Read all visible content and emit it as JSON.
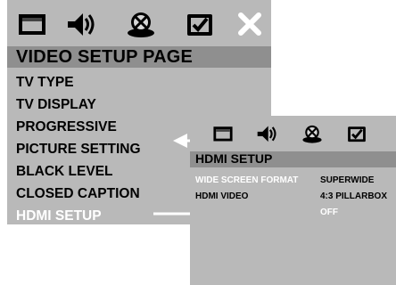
{
  "main_panel": {
    "icons": [
      "tv-screen-icon",
      "speaker-sound-icon",
      "disc-icon",
      "checked-screen-icon",
      "close-icon"
    ],
    "title": "VIDEO SETUP PAGE",
    "menu_items": [
      {
        "label": "TV TYPE",
        "active": false
      },
      {
        "label": "TV DISPLAY",
        "active": false
      },
      {
        "label": "PROGRESSIVE",
        "active": false
      },
      {
        "label": "PICTURE SETTING",
        "active": false
      },
      {
        "label": "BLACK LEVEL",
        "active": false
      },
      {
        "label": "CLOSED CAPTION",
        "active": false
      },
      {
        "label": "HDMI SETUP",
        "active": true
      }
    ]
  },
  "sub_panel": {
    "icons": [
      "tv-screen-icon",
      "speaker-sound-icon",
      "disc-icon",
      "checked-screen-icon"
    ],
    "title": "HDMI SETUP",
    "options": [
      {
        "label": "WIDE SCREEN FORMAT",
        "selected": true
      },
      {
        "label": "HDMI VIDEO",
        "selected": false
      }
    ],
    "values": [
      {
        "label": "SUPERWIDE",
        "highlight": false
      },
      {
        "label": "4:3 PILLARBOX",
        "highlight": false
      },
      {
        "label": "OFF",
        "highlight": true
      }
    ]
  },
  "colors": {
    "panel_bg": "#b9b9b9",
    "header_bg": "#8f8f8f",
    "text": "#000000",
    "active_text": "#ffffff"
  }
}
